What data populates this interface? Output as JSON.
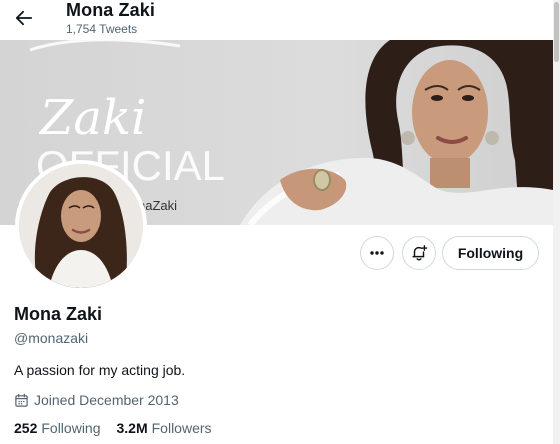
{
  "header": {
    "back_icon": "arrow-left-icon",
    "title": "Mona Zaki",
    "subtitle": "1,754 Tweets"
  },
  "banner": {
    "text_line1": "Zaki",
    "text_line2": "OFFICIAL",
    "text_line3": "naZaki"
  },
  "actions": {
    "more_icon": "more-dots-icon",
    "notify_icon": "bell-plus-icon",
    "following_label": "Following"
  },
  "profile": {
    "name": "Mona Zaki",
    "handle": "@monazaki",
    "bio": "A passion for my acting job.",
    "joined_icon": "calendar-icon",
    "joined": "Joined December 2013",
    "following_count": "252",
    "following_label": "Following",
    "followers_count": "3.2M",
    "followers_label": "Followers"
  },
  "colors": {
    "text_primary": "#0f1419",
    "text_secondary": "#536471",
    "border": "#cfd9de",
    "banner_bg": "#d9d9d9"
  }
}
